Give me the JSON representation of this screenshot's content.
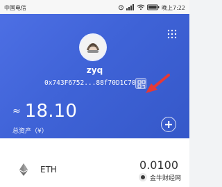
{
  "status_bar": {
    "carrier": "中国电信",
    "time": "晚上7:22"
  },
  "wallet": {
    "name": "zyq",
    "address": "0x743F6752...88f70D1C70",
    "approx_symbol": "≈",
    "total_value": "18.10",
    "total_assets_label": "总资产（¥）"
  },
  "assets": [
    {
      "symbol": "ETH",
      "amount": "0.0100"
    }
  ],
  "watermark": {
    "text": "金牛财经网"
  },
  "colors": {
    "header_gradient_start": "#4d6fe4",
    "header_gradient_end": "#3558c9",
    "annotation_red": "#e53935"
  },
  "icons": {
    "menu": "grid-dots-icon",
    "qr": "qr-code-icon",
    "add": "add-circle-icon",
    "eth": "ethereum-icon"
  }
}
